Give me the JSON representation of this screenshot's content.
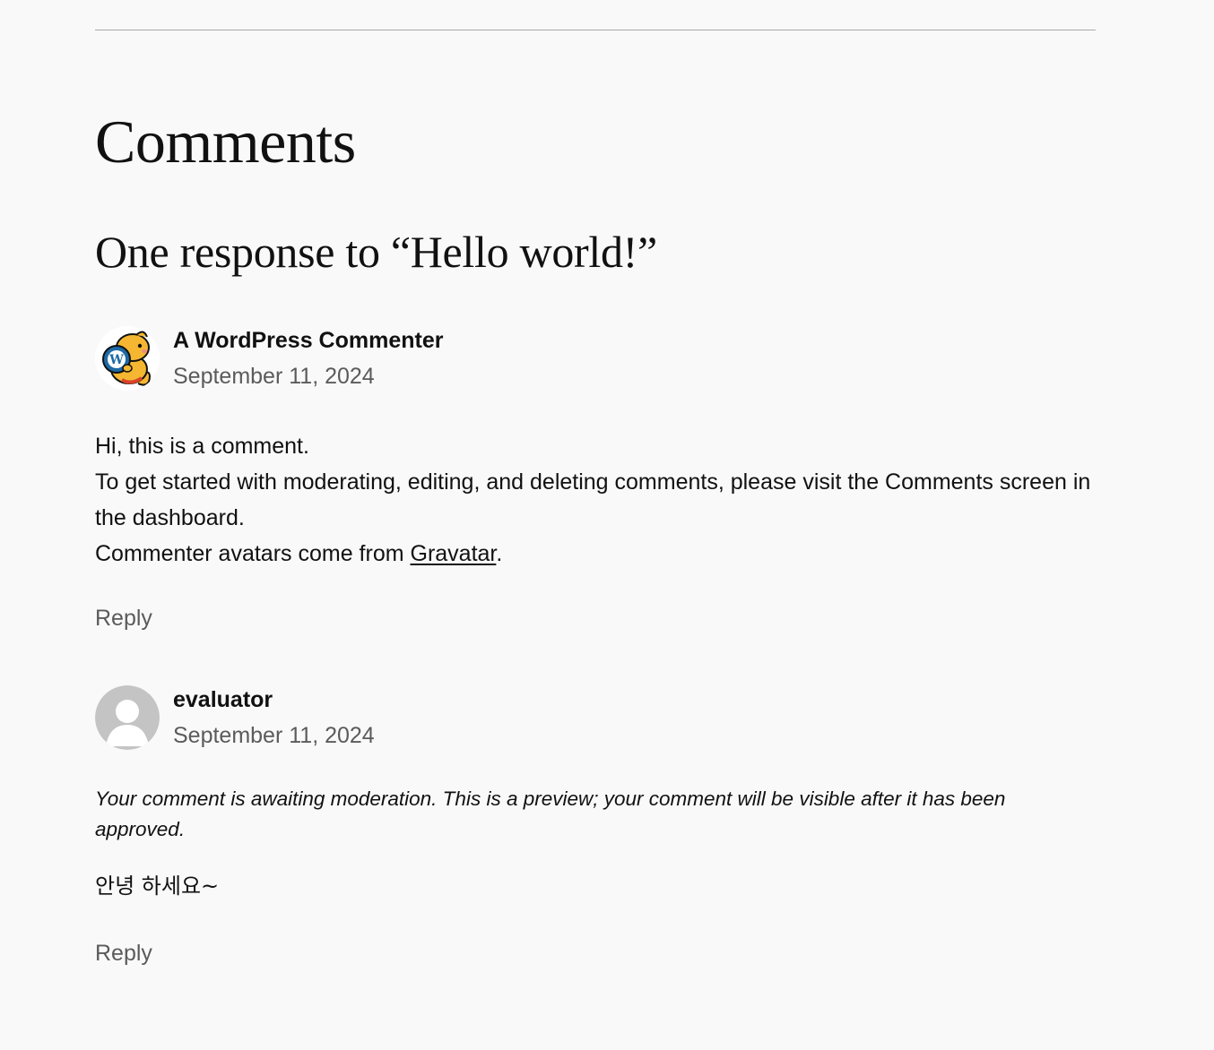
{
  "comments_section": {
    "title": "Comments",
    "count_heading": "One response to “Hello world!”"
  },
  "comments": [
    {
      "author": "A WordPress Commenter",
      "date": "September 11, 2024",
      "avatar": "wapuu-avatar",
      "body": {
        "line1": "Hi, this is a comment.",
        "line2": "To get started with moderating, editing, and deleting comments, please visit the Comments screen in the dashboard.",
        "line3_prefix": "Commenter avatars come from ",
        "line3_link": "Gravatar",
        "line3_suffix": "."
      },
      "reply_label": "Reply"
    },
    {
      "author": "evaluator",
      "date": "September 11, 2024",
      "avatar": "default-user-avatar",
      "moderation_notice": "Your comment is awaiting moderation. This is a preview; your comment will be visible after it has been approved.",
      "text": "안녕 하세요~",
      "reply_label": "Reply"
    }
  ],
  "colors": {
    "background": "#f9f9f9",
    "text": "#111111",
    "muted": "#5b5b5b",
    "separator": "#a9a9a9"
  }
}
